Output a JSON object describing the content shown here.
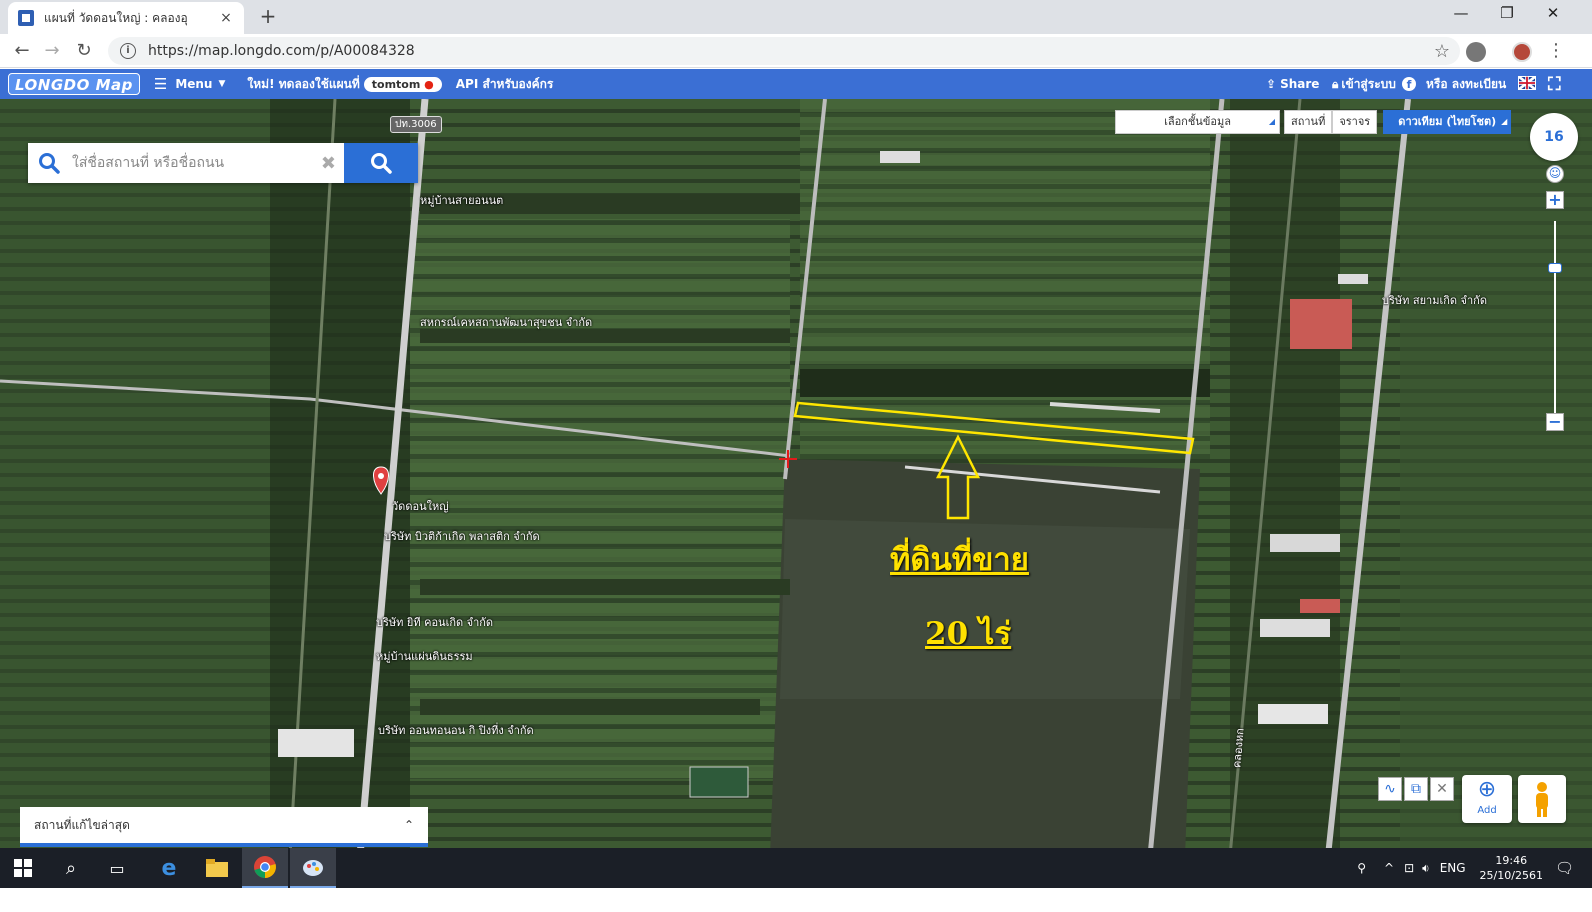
{
  "browser": {
    "tab_title": "แผนที่ วัดดอนใหญ่ : คลองอุ",
    "tab_close": "×",
    "new_tab": "+",
    "url": "https://map.longdo.com/p/A00084328",
    "window_controls": {
      "minimize": "—",
      "restore": "❐",
      "close": "✕"
    }
  },
  "header": {
    "logo": "LONGDO Map",
    "menu_label": "Menu",
    "promo_text": "ใหม่! ทดลองใช้แผนที่",
    "tomtom_label": "tomtom",
    "api_label": "API สำหรับองค์กร",
    "share_label": "Share",
    "login_label": "เข้าสู่ระบบ",
    "register_label": "หรือ ลงทะเบียน"
  },
  "search": {
    "placeholder": "ใส่ชื่อสถานที่ หรือชื่อถนน",
    "clear_glyph": "✖"
  },
  "layers": {
    "select_label": "เลือกชั้นข้อมูล",
    "place_tab": "สถานที่",
    "traffic_tab": "จราจร",
    "base_layer": "ดาวเทียม (ไทยโชต)"
  },
  "zoom": {
    "level": "16",
    "in": "+",
    "out": "−"
  },
  "map_labels": {
    "road_tag": "ปท.3006",
    "village1": "หมู่บ้านสายอนนต",
    "coop": "สหกรณ์เคหสถานพัฒนาสุขชน จำกัด",
    "company_east": "บริษัท สยามเกิด จำกัด",
    "temple": "วัดดอนใหญ่",
    "company2": "บริษัท บิวติก้าเกิด พลาสติก จำกัด",
    "company3": "บริษัท ยิที คอนเกิด จำกัด",
    "village2": "หมู่บ้านแผ่นดินธรรม",
    "company4": "บริษัท ออนทอนอน กิ ปิงที่ง จำกัด",
    "canal": "คลองหก"
  },
  "annotation": {
    "line1": "ที่ดินที่ขาย",
    "line2": "20 ไร่",
    "color": "#ffe100"
  },
  "recent_panel": {
    "label": "สถานที่แก้ไขล่าสุด",
    "toggle": "⌃"
  },
  "tools": {
    "add_label": "Add"
  },
  "taskbar": {
    "lang": "ENG",
    "time": "19:46",
    "date": "25/10/2561"
  }
}
